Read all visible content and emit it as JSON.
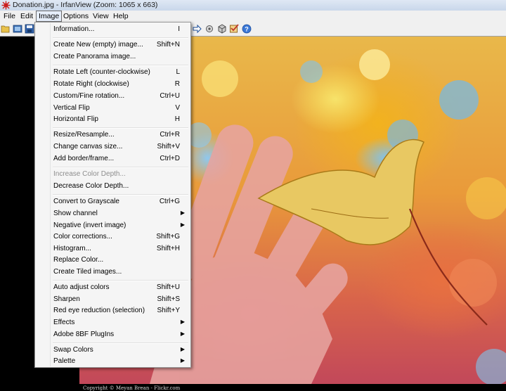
{
  "window": {
    "title": "Donation.jpg - IrfanView (Zoom: 1065 x 663)"
  },
  "menubar": {
    "file": "File",
    "edit": "Edit",
    "image": "Image",
    "options": "Options",
    "view": "View",
    "help": "Help"
  },
  "toolbar": {
    "icons": [
      "open-folder-icon",
      "thumbnails-icon",
      "save-icon",
      "next-arrow-icon",
      "settings-icon",
      "cube-icon",
      "checkbox-icon",
      "help-icon"
    ]
  },
  "image_menu": {
    "information": {
      "label": "Information...",
      "shortcut": "I"
    },
    "create_new": {
      "label": "Create New (empty) image...",
      "shortcut": "Shift+N"
    },
    "create_panorama": {
      "label": "Create Panorama image..."
    },
    "rotate_left": {
      "label": "Rotate Left (counter-clockwise)",
      "shortcut": "L"
    },
    "rotate_right": {
      "label": "Rotate Right (clockwise)",
      "shortcut": "R"
    },
    "custom_rotation": {
      "label": "Custom/Fine rotation...",
      "shortcut": "Ctrl+U"
    },
    "vertical_flip": {
      "label": "Vertical Flip",
      "shortcut": "V"
    },
    "horizontal_flip": {
      "label": "Horizontal Flip",
      "shortcut": "H"
    },
    "resize": {
      "label": "Resize/Resample...",
      "shortcut": "Ctrl+R"
    },
    "canvas_size": {
      "label": "Change canvas size...",
      "shortcut": "Shift+V"
    },
    "add_border": {
      "label": "Add border/frame...",
      "shortcut": "Ctrl+D"
    },
    "increase_depth": {
      "label": "Increase Color Depth..."
    },
    "decrease_depth": {
      "label": "Decrease Color Depth..."
    },
    "grayscale": {
      "label": "Convert to Grayscale",
      "shortcut": "Ctrl+G"
    },
    "show_channel": {
      "label": "Show channel"
    },
    "negative": {
      "label": "Negative (invert image)"
    },
    "color_corrections": {
      "label": "Color corrections...",
      "shortcut": "Shift+G"
    },
    "histogram": {
      "label": "Histogram...",
      "shortcut": "Shift+H"
    },
    "replace_color": {
      "label": "Replace Color..."
    },
    "tiled_images": {
      "label": "Create Tiled images..."
    },
    "auto_adjust": {
      "label": "Auto adjust colors",
      "shortcut": "Shift+U"
    },
    "sharpen": {
      "label": "Sharpen",
      "shortcut": "Shift+S"
    },
    "red_eye": {
      "label": "Red eye reduction (selection)",
      "shortcut": "Shift+Y"
    },
    "effects": {
      "label": "Effects"
    },
    "plugins": {
      "label": "Adobe 8BF PlugIns"
    },
    "swap_colors": {
      "label": "Swap Colors"
    },
    "palette": {
      "label": "Palette"
    }
  },
  "image_caption": "Copyright © Meyan Brean - Flickr.com",
  "colors": {
    "menu_bg": "#f5f5f5",
    "menubar_bg": "#f0f0f0",
    "disabled_text": "#8d8d8d",
    "title_icon": "#cc1f1f"
  }
}
